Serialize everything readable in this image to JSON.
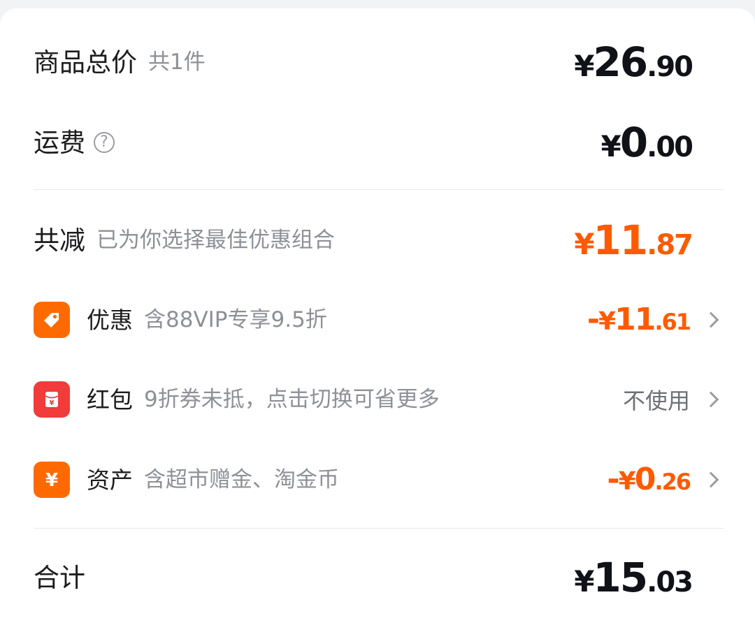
{
  "summary": {
    "goods_total": {
      "label": "商品总价",
      "sub": "共1件",
      "currency": "¥",
      "int": "26",
      "dec": ".90"
    },
    "shipping": {
      "label": "运费",
      "help_icon": "question-circle-icon",
      "currency": "¥",
      "int": "0",
      "dec": ".00"
    },
    "total_discount": {
      "label": "共减",
      "sub": "已为你选择最佳优惠组合",
      "currency": "¥",
      "int": "11",
      "dec": ".87"
    },
    "discounts": [
      {
        "icon": "tag-icon",
        "label": "优惠",
        "sub": "含88VIP专享9.5折",
        "sign": "-",
        "currency": "¥",
        "int": "11",
        "dec": ".61"
      },
      {
        "icon": "red-envelope-icon",
        "label": "红包",
        "sub": "9折券未抵，点击切换可省更多",
        "value_text": "不使用"
      },
      {
        "icon": "yen-coin-icon",
        "label": "资产",
        "sub": "含超市赠金、淘金币",
        "sign": "-",
        "currency": "¥",
        "int": "0",
        "dec": ".26"
      }
    ],
    "grand_total": {
      "label": "合计",
      "currency": "¥",
      "int": "15",
      "dec": ".03"
    }
  },
  "colors": {
    "accent": "#ff5a00",
    "price_black": "#111218",
    "badge_orange": "#ff6a00",
    "badge_red": "#f23b3b"
  }
}
